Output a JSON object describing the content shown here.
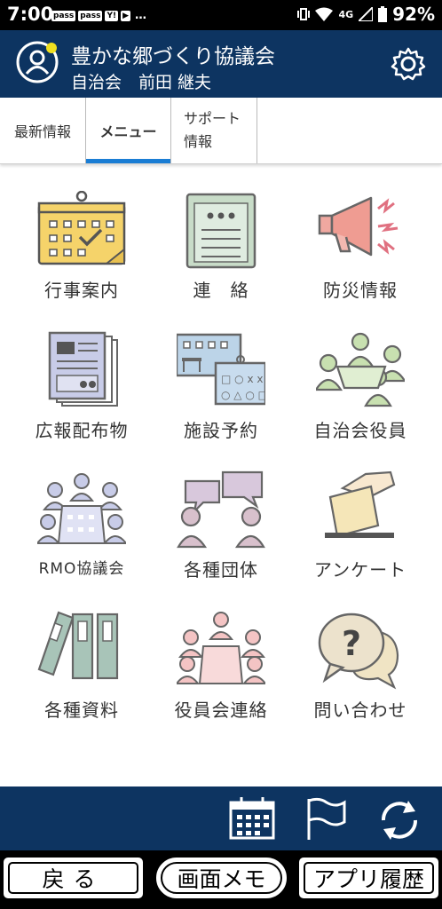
{
  "status_bar": {
    "time": "7:00",
    "notifications": [
      "pass",
      "pass",
      "Y!",
      "▶",
      "…"
    ],
    "network": "4G",
    "battery": "92%"
  },
  "header": {
    "title": "豊かな郷づくり協議会",
    "subtitle": "自治会　前田 継夫"
  },
  "tabs": [
    {
      "label": "最新情報",
      "active": false
    },
    {
      "label": "メニュー",
      "active": true
    },
    {
      "label_line1": "サポート",
      "label_line2": "情報",
      "active": false
    }
  ],
  "menu": [
    {
      "label": "行事案内",
      "icon": "event-calendar-icon"
    },
    {
      "label": "連　絡",
      "icon": "clipboard-icon"
    },
    {
      "label": "防災情報",
      "icon": "megaphone-icon"
    },
    {
      "label": "広報配布物",
      "icon": "newsletter-icon"
    },
    {
      "label": "施設予約",
      "icon": "facility-booking-icon"
    },
    {
      "label": "自治会役員",
      "icon": "officers-meeting-icon"
    },
    {
      "label": "RMO協議会",
      "icon": "council-meeting-icon"
    },
    {
      "label": "各種団体",
      "icon": "groups-chat-icon"
    },
    {
      "label": "アンケート",
      "icon": "ballot-box-icon"
    },
    {
      "label": "各種資料",
      "icon": "binders-icon"
    },
    {
      "label": "役員会連絡",
      "icon": "officers-council-icon"
    },
    {
      "label": "問い合わせ",
      "icon": "inquiry-bubble-icon"
    }
  ],
  "toolbar": {
    "icons": [
      "calendar-icon",
      "flag-icon",
      "refresh-icon"
    ]
  },
  "nav": {
    "back": "戻る",
    "memo": "画面メモ",
    "history": "アプリ履歴"
  },
  "colors": {
    "header_bg": "#0d3461",
    "tab_accent": "#1a7dd4",
    "notification_dot": "#f0e020"
  }
}
